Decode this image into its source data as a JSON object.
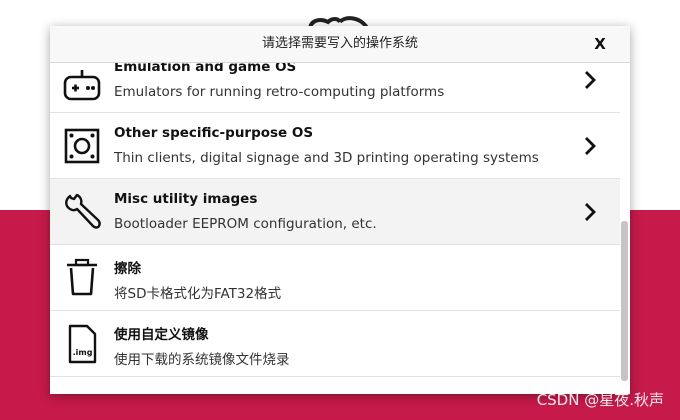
{
  "dialog": {
    "title": "请选择需要写入的操作系统",
    "close_label": "X"
  },
  "items": [
    {
      "title": "Emulation and game OS",
      "description": "Emulators for running retro-computing platforms",
      "icon": "gamepad-icon"
    },
    {
      "title": "Other specific-purpose OS",
      "description": "Thin clients, digital signage and 3D printing operating systems",
      "icon": "speaker-box-icon"
    },
    {
      "title": "Misc utility images",
      "description": "Bootloader EEPROM configuration, etc.",
      "icon": "wrench-icon"
    },
    {
      "title": "擦除",
      "description": "将SD卡格式化为FAT32格式",
      "icon": "trash-icon"
    },
    {
      "title": "使用自定义镜像",
      "description": "使用下载的系统镜像文件烧录",
      "icon": "image-file-icon",
      "icon_text": ".img"
    }
  ],
  "watermark": "CSDN @星夜.秋声",
  "colors": {
    "brand_red": "#c51a4a",
    "row_highlight": "#f3f3f3",
    "scrollbar_thumb": "#c4c4c4"
  }
}
